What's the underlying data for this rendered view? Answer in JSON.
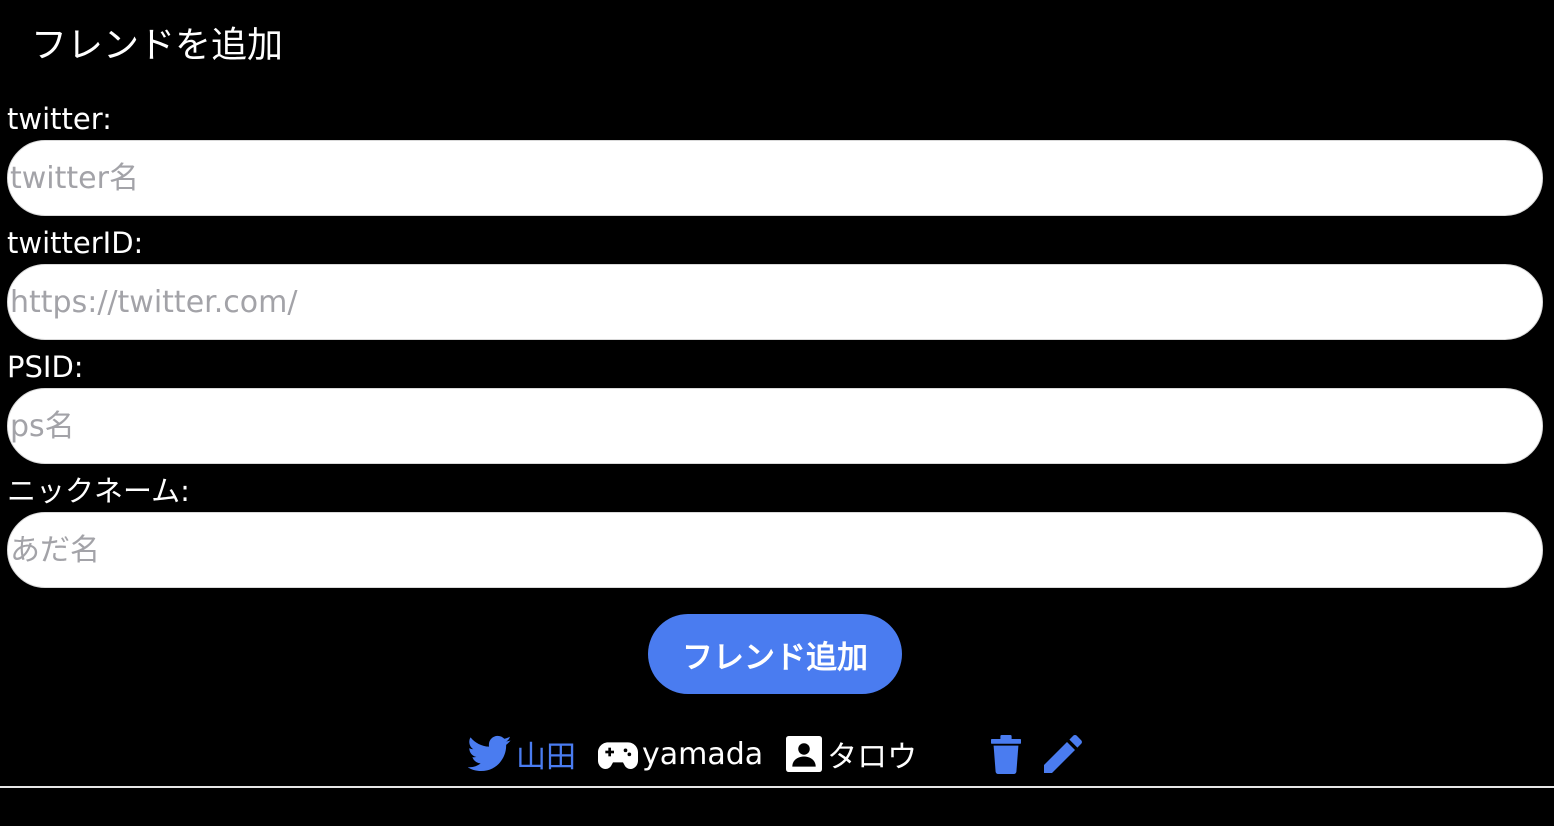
{
  "page": {
    "title": "フレンドを追加"
  },
  "form": {
    "twitter": {
      "label": "twitter:",
      "placeholder": "twitter名",
      "value": ""
    },
    "twitter_id": {
      "label": "twitterID:",
      "placeholder": "https://twitter.com/",
      "value": ""
    },
    "psid": {
      "label": "PSID:",
      "placeholder": "ps名",
      "value": ""
    },
    "nickname": {
      "label": "ニックネーム:",
      "placeholder": "あだ名",
      "value": ""
    },
    "submit_label": "フレンド追加"
  },
  "friends": [
    {
      "twitter_name": "山田",
      "ps_name": "yamada",
      "nickname": "タロウ",
      "icons": [
        "twitter-icon",
        "gamepad-icon",
        "contact-icon",
        "trash-icon",
        "pencil-icon"
      ]
    }
  ],
  "colors": {
    "background": "#000000",
    "accent": "#4a7cf0",
    "text": "#ffffff",
    "placeholder": "#a3a3a8"
  }
}
